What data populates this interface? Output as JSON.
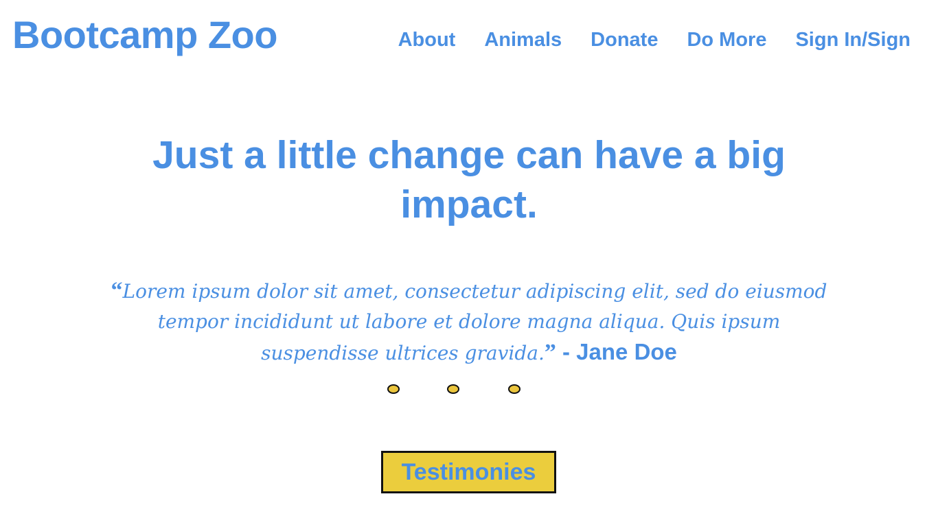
{
  "header": {
    "brand": "Bootcamp Zoo",
    "nav": [
      {
        "label": "About"
      },
      {
        "label": "Animals"
      },
      {
        "label": "Donate"
      },
      {
        "label": "Do More"
      },
      {
        "label": "Sign In/Sign"
      }
    ]
  },
  "hero": {
    "headline": "Just a little change can have a big impact."
  },
  "testimonial": {
    "open_quote": "“",
    "text": "Lorem ipsum dolor sit amet, consectetur adipiscing elit, sed do eiusmod tempor incididunt ut labore et dolore magna aliqua. Quis ipsum suspendisse ultrices gravida.",
    "close_quote": "”",
    "author": " - Jane Doe",
    "slide_count": 3
  },
  "cta": {
    "label": "Testimonies"
  },
  "colors": {
    "brand_blue": "#4a8fe2",
    "accent_yellow": "#ebcd3d",
    "outline": "#111111",
    "background": "#ffffff"
  }
}
